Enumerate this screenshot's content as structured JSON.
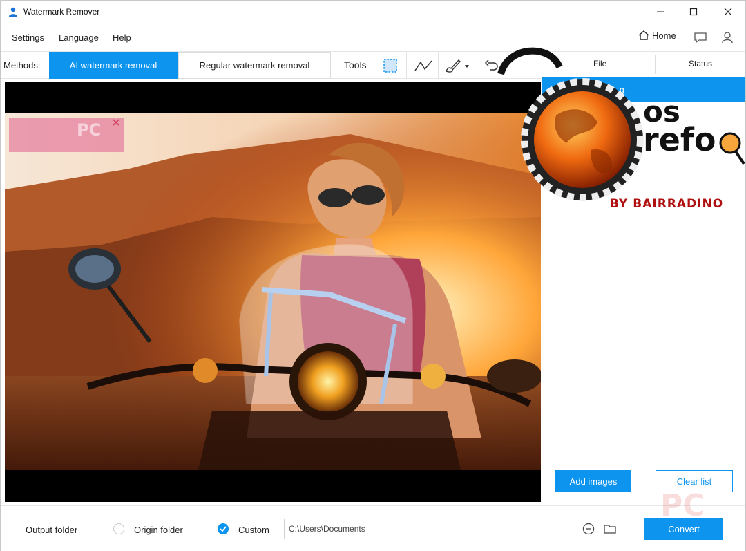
{
  "window": {
    "title": "Watermark Remover",
    "minimize_icon": "minimize-icon",
    "maximize_icon": "maximize-icon",
    "close_icon": "close-icon"
  },
  "menu": {
    "settings": "Settings",
    "language": "Language",
    "help": "Help",
    "home": "Home"
  },
  "toolbar": {
    "methods_label": "Methods:",
    "method_ai": "AI watermark removal",
    "method_regular": "Regular watermark removal",
    "tools_label": "Tools",
    "tools": [
      "rectangle-select-icon",
      "polyline-icon",
      "brush-icon",
      "undo-icon",
      "redo-icon"
    ]
  },
  "file_list": {
    "col_file": "File",
    "col_status": "Status",
    "selected_file_suffix": "g",
    "add_images": "Add images",
    "clear_list": "Clear list"
  },
  "canvas": {
    "watermark_text": "PC"
  },
  "bottom": {
    "output_folder_label": "Output folder",
    "origin_folder": "Origin folder",
    "custom": "Custom",
    "selected_option": "Custom",
    "path_value": "C:\\Users\\Documents",
    "convert": "Convert"
  },
  "overlay": {
    "logo_line1": "os",
    "logo_line2": "refo",
    "logo_sub": "BY BAIRRADINO",
    "stamp": "PC"
  },
  "colors": {
    "accent": "#0d94ef",
    "watermark_box": "#e682a0"
  }
}
